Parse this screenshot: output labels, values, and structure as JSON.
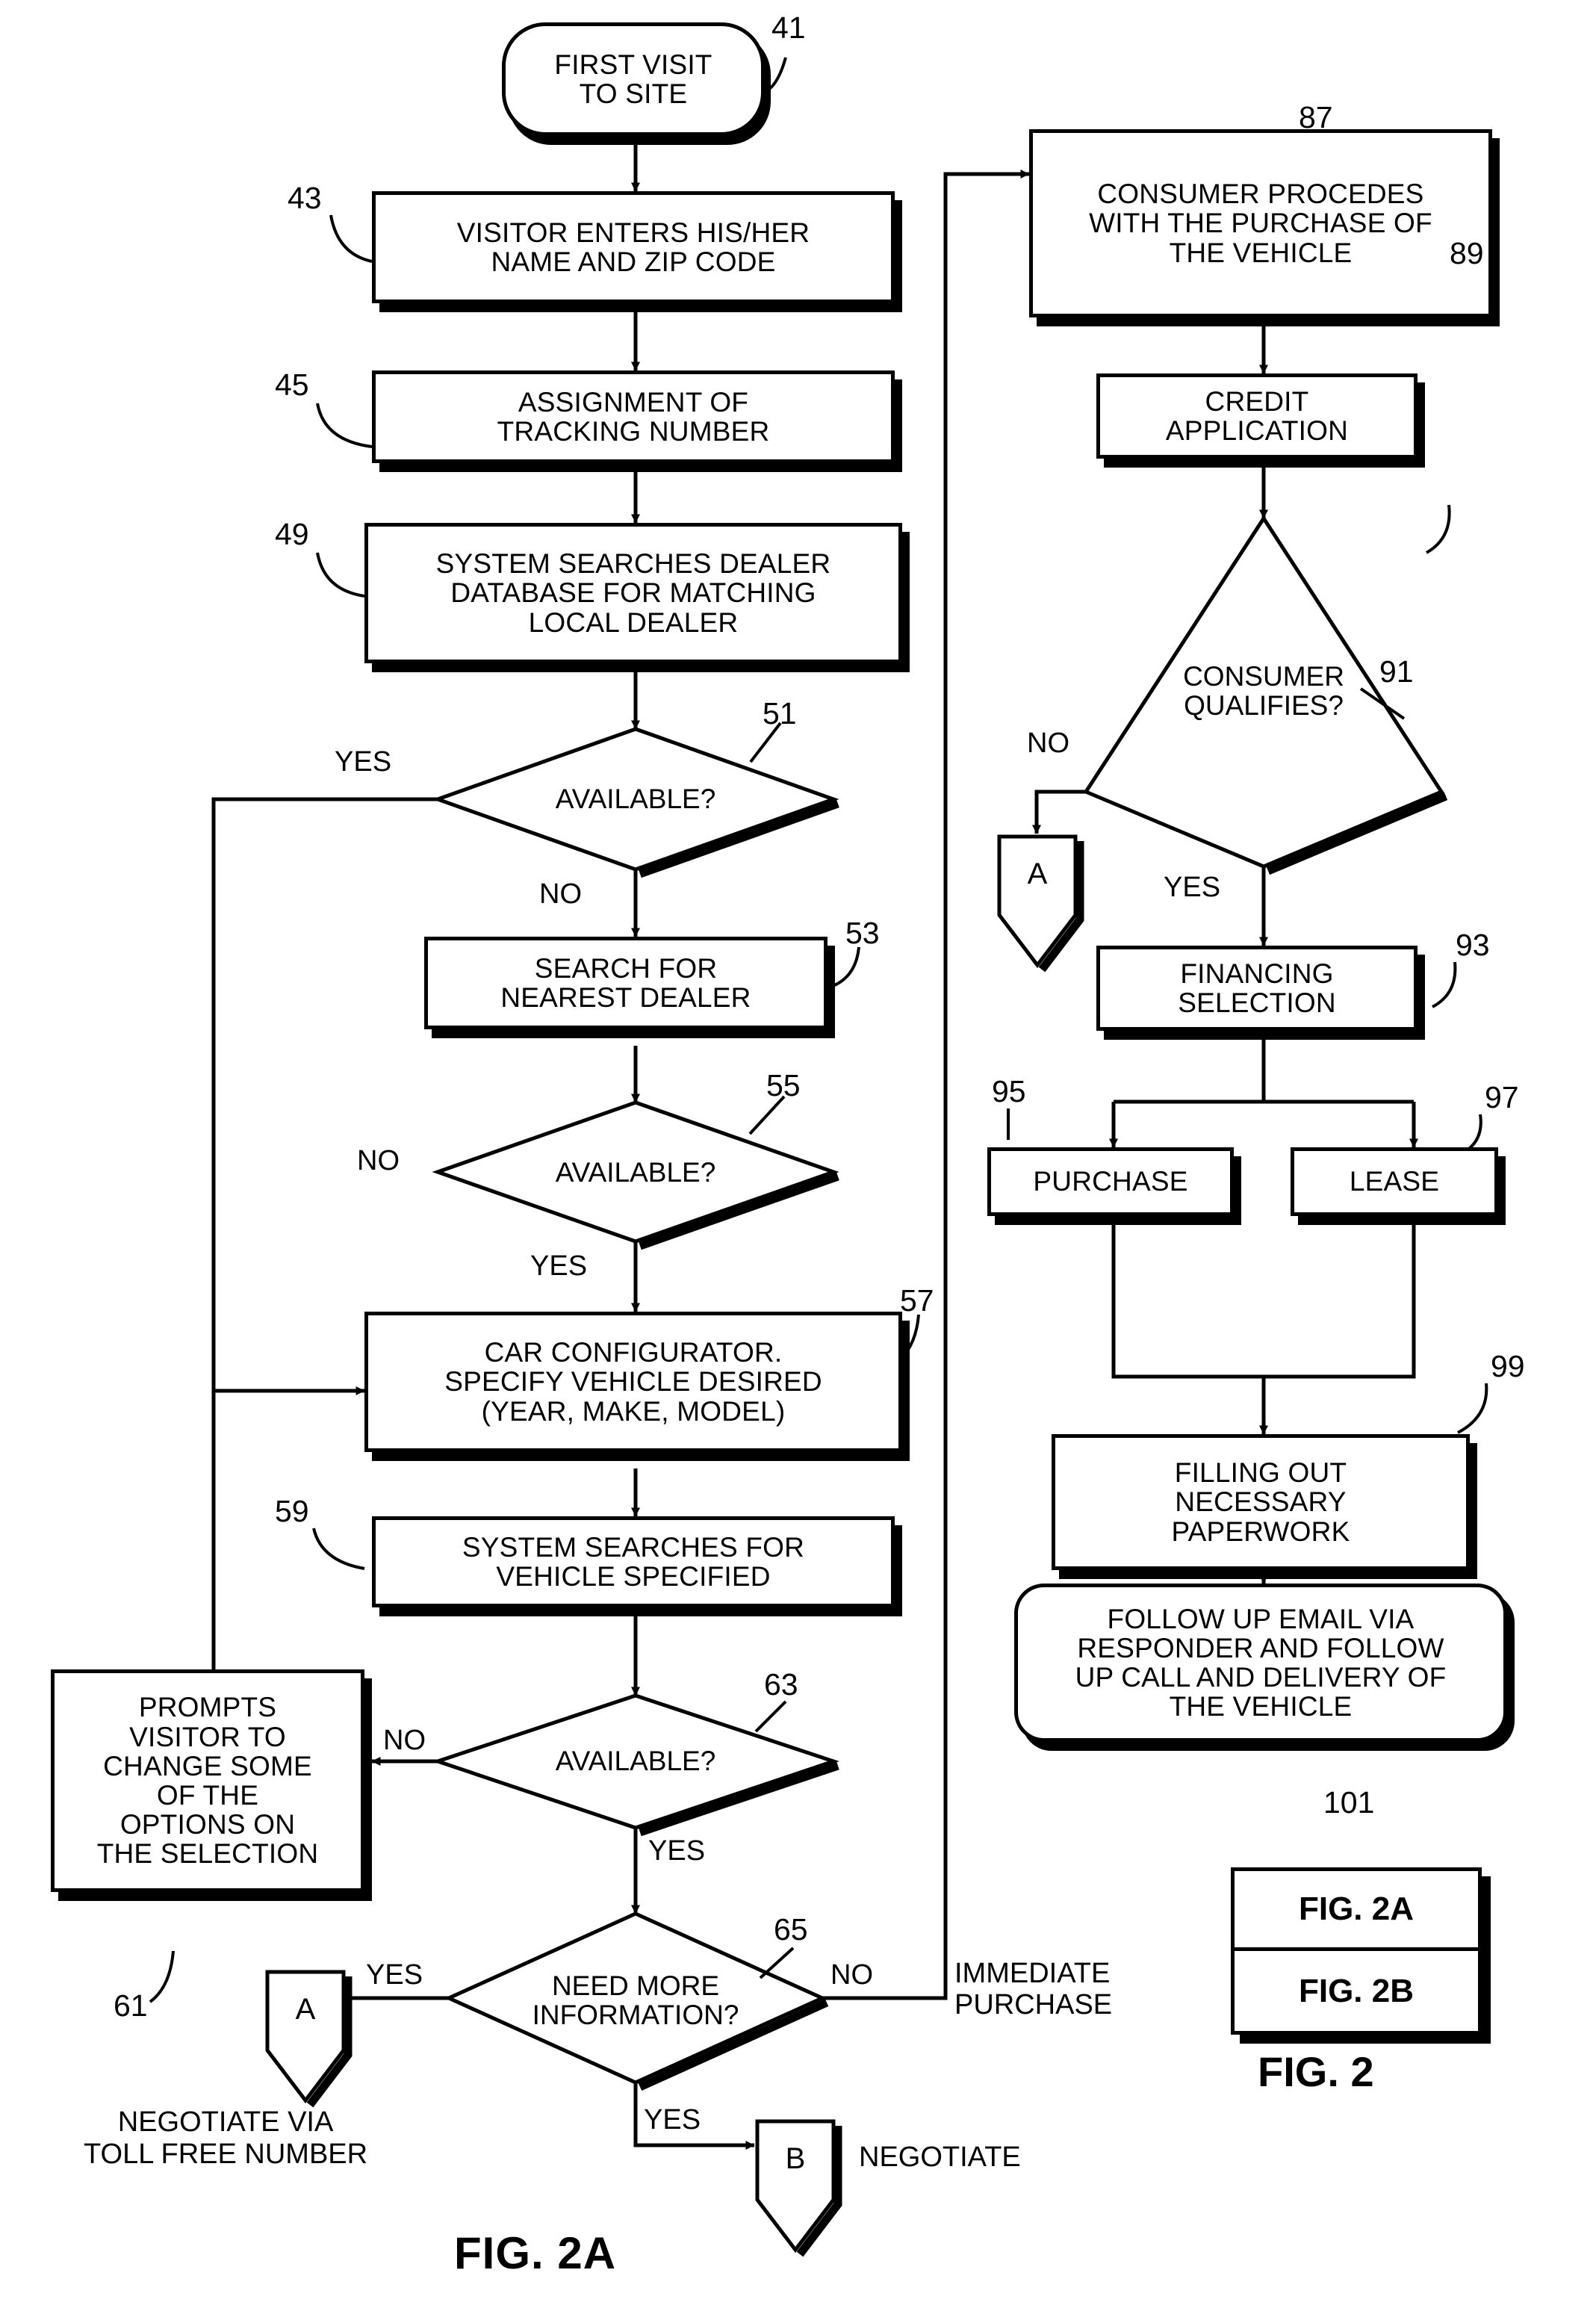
{
  "figure": {
    "caption_main": "FIG. 2A",
    "legend": {
      "row1": "FIG. 2A",
      "row2": "FIG. 2B",
      "caption": "FIG. 2"
    }
  },
  "nodes": [
    {
      "id": "n41",
      "ref": "41",
      "shape": "terminator",
      "text": "FIRST VISIT\nTO SITE"
    },
    {
      "id": "n43",
      "ref": "43",
      "shape": "process",
      "text": "VISITOR ENTERS HIS/HER\nNAME AND ZIP CODE"
    },
    {
      "id": "n45",
      "ref": "45",
      "shape": "process",
      "text": "ASSIGNMENT OF\nTRACKING NUMBER"
    },
    {
      "id": "n49",
      "ref": "49",
      "shape": "process",
      "text": "SYSTEM SEARCHES DEALER\nDATABASE FOR MATCHING\nLOCAL DEALER"
    },
    {
      "id": "n51",
      "ref": "51",
      "shape": "decision",
      "text": "AVAILABLE?"
    },
    {
      "id": "n53",
      "ref": "53",
      "shape": "process",
      "text": "SEARCH FOR\nNEAREST DEALER"
    },
    {
      "id": "n55",
      "ref": "55",
      "shape": "decision",
      "text": "AVAILABLE?"
    },
    {
      "id": "n57",
      "ref": "57",
      "shape": "process",
      "text": "CAR CONFIGURATOR.\nSPECIFY VEHICLE DESIRED\n(YEAR, MAKE, MODEL)"
    },
    {
      "id": "n59",
      "ref": "59",
      "shape": "process",
      "text": "SYSTEM SEARCHES FOR\nVEHICLE SPECIFIED"
    },
    {
      "id": "n61",
      "ref": "61",
      "shape": "process",
      "text": "PROMPTS\nVISITOR TO\nCHANGE SOME\nOF THE\nOPTIONS ON\nTHE SELECTION"
    },
    {
      "id": "n63",
      "ref": "63",
      "shape": "decision",
      "text": "AVAILABLE?"
    },
    {
      "id": "n65",
      "ref": "65",
      "shape": "decision",
      "text": "NEED MORE\nINFORMATION?"
    },
    {
      "id": "n87",
      "ref": "87",
      "shape": "process",
      "text": "CONSUMER PROCEDES\nWITH THE PURCHASE OF\nTHE VEHICLE"
    },
    {
      "id": "n89",
      "ref": "89",
      "shape": "process",
      "text": "CREDIT\nAPPLICATION"
    },
    {
      "id": "n91",
      "ref": "91",
      "shape": "decision",
      "text": "CONSUMER\nQUALIFIES?"
    },
    {
      "id": "n93",
      "ref": "93",
      "shape": "process",
      "text": "FINANCING\nSELECTION"
    },
    {
      "id": "n95",
      "ref": "95",
      "shape": "process",
      "text": "PURCHASE"
    },
    {
      "id": "n97",
      "ref": "97",
      "shape": "process",
      "text": "LEASE"
    },
    {
      "id": "n99",
      "ref": "99",
      "shape": "process",
      "text": "FILLING OUT\nNECESSARY\nPAPERWORK"
    },
    {
      "id": "n101",
      "ref": "101",
      "shape": "terminator",
      "text": "FOLLOW UP EMAIL VIA\nRESPONDER AND FOLLOW\nUP CALL AND DELIVERY OF\nTHE VEHICLE"
    }
  ],
  "connectors": [
    {
      "id": "cA1",
      "label": "A",
      "caption": "NEGOTIATE VIA\nTOLL FREE NUMBER"
    },
    {
      "id": "cB1",
      "label": "B",
      "caption": "NEGOTIATE"
    },
    {
      "id": "cA2",
      "label": "A",
      "caption": ""
    }
  ],
  "edge_labels": {
    "e51_yes": "YES",
    "e51_no": "NO",
    "e55_no": "NO",
    "e55_yes": "YES",
    "e63_no": "NO",
    "e63_yes": "YES",
    "e65_yes_left": "YES",
    "e65_no": "NO",
    "e65_yes_bottom": "YES",
    "e91_no": "NO",
    "e91_yes": "YES",
    "immediate_purchase": "IMMEDIATE\nPURCHASE",
    "negotiate_b": "NEGOTIATE",
    "negotiate_toll": "NEGOTIATE VIA\nTOLL FREE NUMBER"
  },
  "texts": {
    "n41": "FIRST VISIT\nTO SITE",
    "n43": "VISITOR ENTERS HIS/HER\nNAME AND ZIP CODE",
    "n45": "ASSIGNMENT OF\nTRACKING NUMBER",
    "n49": "SYSTEM SEARCHES DEALER\nDATABASE FOR MATCHING\nLOCAL DEALER",
    "n51": "AVAILABLE?",
    "n53": "SEARCH FOR\nNEAREST DEALER",
    "n55": "AVAILABLE?",
    "n57": "CAR CONFIGURATOR.\nSPECIFY VEHICLE DESIRED\n(YEAR, MAKE, MODEL)",
    "n59": "SYSTEM SEARCHES FOR\nVEHICLE SPECIFIED",
    "n61": "PROMPTS\nVISITOR TO\nCHANGE SOME\nOF THE\nOPTIONS ON\nTHE SELECTION",
    "n63": "AVAILABLE?",
    "n65": "NEED MORE\nINFORMATION?",
    "n87": "CONSUMER PROCEDES\nWITH THE PURCHASE OF\nTHE VEHICLE",
    "n89": "CREDIT\nAPPLICATION",
    "n91": "CONSUMER\nQUALIFIES?",
    "n93": "FINANCING\nSELECTION",
    "n95": "PURCHASE",
    "n97": "LEASE",
    "n99": "FILLING OUT\nNECESSARY\nPAPERWORK",
    "n101": "FOLLOW UP EMAIL VIA\nRESPONDER AND FOLLOW\nUP CALL AND DELIVERY OF\nTHE VEHICLE",
    "connA1": "A",
    "connB1": "B",
    "connA2": "A"
  },
  "refs": {
    "r41": "41",
    "r43": "43",
    "r45": "45",
    "r49": "49",
    "r51": "51",
    "r53": "53",
    "r55": "55",
    "r57": "57",
    "r59": "59",
    "r61": "61",
    "r63": "63",
    "r65": "65",
    "r87": "87",
    "r89": "89",
    "r91": "91",
    "r93": "93",
    "r95": "95",
    "r97": "97",
    "r99": "99",
    "r101": "101"
  },
  "colors": {
    "ink": "#000000",
    "paper": "#ffffff"
  }
}
